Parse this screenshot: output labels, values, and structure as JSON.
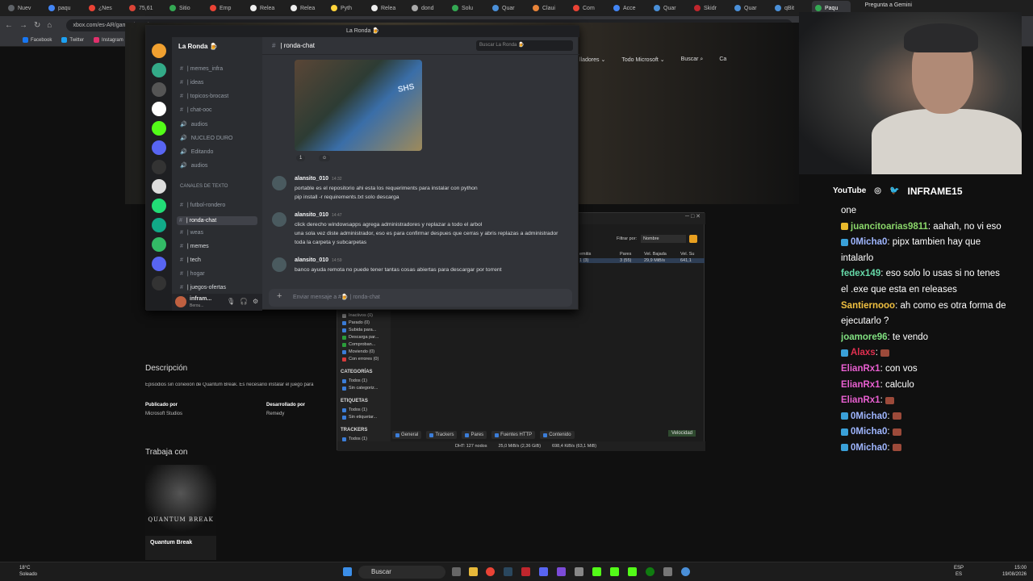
{
  "browser": {
    "tabs": [
      "Nuev",
      "paqu",
      "¿Nes",
      "75,61",
      "Sitio",
      "Emp",
      "Relea",
      "Relea",
      "Pyth",
      "Relea",
      "dond",
      "Solu",
      "Quar",
      "Claui",
      "Com",
      "Acce",
      "Quar",
      "Skidr",
      "Quar",
      "qBit",
      "Paqu"
    ],
    "gemini": "Pregunta a Gemini",
    "url": "xbox.com/es-AR/games/store/...",
    "bookmarks": [
      "Facebook",
      "Twitter",
      "Instagram",
      "Yo",
      "CS 1.6 | Dashboard",
      "Netflix",
      "Prime Video",
      "Releases",
      "Amazon",
      "JUAN TURR"
    ]
  },
  "xbox": {
    "nav": [
      "lladores ⌄",
      "Todo Microsoft ⌄",
      "Buscar ⌕",
      "Ca"
    ],
    "description_title": "Descripción",
    "description_text": "Episodios sin conexión de Quantum Break. Es necesario instalar el juego para",
    "published_label": "Publicado por",
    "published_value": "Microsoft Studios",
    "developed_label": "Desarrollado por",
    "developed_value": "Remedy",
    "works_with": "Trabaja con",
    "card_title": "Quantum Break",
    "card_art": "QUANTUM BREAK"
  },
  "discord": {
    "window_title": "La Ronda 🍺",
    "server_name": "La Ronda 🍺",
    "channel_top": [
      "| memes_infra",
      "| ideas",
      "| topicos-brocast",
      "| chat-ooc",
      "audios",
      "NUCLEO DURO",
      "Editando",
      "audios"
    ],
    "category": "CANALES DE TEXTO",
    "text_channels": [
      "| futbol-rondero",
      "| ronda-chat",
      "| weas",
      "| memes",
      "| tech",
      "| hogar",
      "| juegos-ofertas"
    ],
    "user": "infram...",
    "user_status": "Berou...",
    "header_channel": "| ronda-chat",
    "search_placeholder": "Buscar La Ronda 🍺",
    "meme_logo": "SHS",
    "reaction_count": "1",
    "messages": [
      {
        "author": "alansito_010",
        "time": "14:32",
        "lines": [
          "portable es el repositorio ahi esta los requeriments para instalar con python",
          "pip install -r requirements.txt solo descarga"
        ]
      },
      {
        "author": "alansito_010",
        "time": "14:47",
        "lines": [
          "click derecho windowsapps agrega administradores y replazar a todo el arbol",
          "una sola vez diste administrador, eso es para confirmar despues que cerras y abris replazas a administrador toda la carpeta y subcarpetas"
        ]
      },
      {
        "author": "alansito_010",
        "time": "14:59",
        "lines": [
          "banco ayuda remota no puede tener tantas cosas abiertas para descargar por torrent"
        ]
      }
    ],
    "input_placeholder": "Enviar mensaje a #🍺 | ronda-chat"
  },
  "qbittorrent": {
    "filter_label": "Filtrar por:",
    "filter_value": "Nombre",
    "columns": [
      "emitis",
      "Pares",
      "Vel. Bajada",
      "Vel. Su"
    ],
    "row": [
      "1 (3)",
      "3 (55)",
      "29,9 MiB/s",
      "641,1"
    ],
    "status_items": [
      "Inactivos (0)",
      "Parado (0)",
      "Subida para...",
      "Descarga par...",
      "Comproban...",
      "Moviendo (0)",
      "Con errores (0)"
    ],
    "categories_title": "CATEGORÍAS",
    "categories": [
      "Todos (1)",
      "Sin categoriz..."
    ],
    "tags_title": "ETIQUETAS",
    "tags": [
      "Todos (1)",
      "Sin etiquetar..."
    ],
    "trackers_title": "TRACKERS",
    "trackers": [
      "Todos (1)"
    ],
    "tabs": [
      "General",
      "Trackers",
      "Pares",
      "Fuentes HTTP",
      "Contenido"
    ],
    "speed_tab": "Velocidad",
    "dht": "DHT: 127 nodos",
    "down": "25,0 MiB/s (2,36 GiB)",
    "up": "698,4 KiB/s (63,1 MiB)"
  },
  "stream": {
    "youtube": "YouTube",
    "brand": "INFRAME15",
    "chat": [
      {
        "user": "",
        "color": "#ffffff",
        "text": "one"
      },
      {
        "user": "juancitoarias9811",
        "color": "#8ad66a",
        "text": ": aahah, no vi eso",
        "badge": "#e8b92c"
      },
      {
        "user": "0Micha0",
        "color": "#9fb6ff",
        "text": ": pipx tambien hay que",
        "badge": "#3aa0d8"
      },
      {
        "user": "",
        "color": "#ffffff",
        "text": "intalarlo"
      },
      {
        "user": "fedex149",
        "color": "#66d9a8",
        "text": ": eso solo lo usas si no tenes"
      },
      {
        "user": "",
        "color": "#ffffff",
        "text": "el .exe que esta en releases"
      },
      {
        "user": "Santiernooo",
        "color": "#f0c040",
        "text": ": ah como es otra forma de"
      },
      {
        "user": "",
        "color": "#ffffff",
        "text": "ejecutarlo ?"
      },
      {
        "user": "joamore96",
        "color": "#80e080",
        "text": ": te vendo"
      },
      {
        "user": "Alaxs",
        "color": "#e03050",
        "text": ": ",
        "badge": "#3aa0d8",
        "emote": true
      },
      {
        "user": "ElianRx1",
        "color": "#e85fd0",
        "text": ": con vos"
      },
      {
        "user": "ElianRx1",
        "color": "#e85fd0",
        "text": ": calculo"
      },
      {
        "user": "ElianRx1",
        "color": "#e85fd0",
        "text": ": ",
        "emote": true
      },
      {
        "user": "0Micha0",
        "color": "#9fb6ff",
        "text": ": ",
        "badge": "#3aa0d8",
        "emote": true
      },
      {
        "user": "0Micha0",
        "color": "#9fb6ff",
        "text": ": ",
        "badge": "#3aa0d8",
        "emote": true
      },
      {
        "user": "0Micha0",
        "color": "#9fb6ff",
        "text": ": ",
        "badge": "#3aa0d8",
        "emote": true
      }
    ]
  },
  "taskbar": {
    "temp": "18°C",
    "weather": "Soleado",
    "search": "Buscar",
    "lang1": "ESP",
    "lang2": "ES",
    "time": "15:00",
    "date": "19/08/2026"
  }
}
